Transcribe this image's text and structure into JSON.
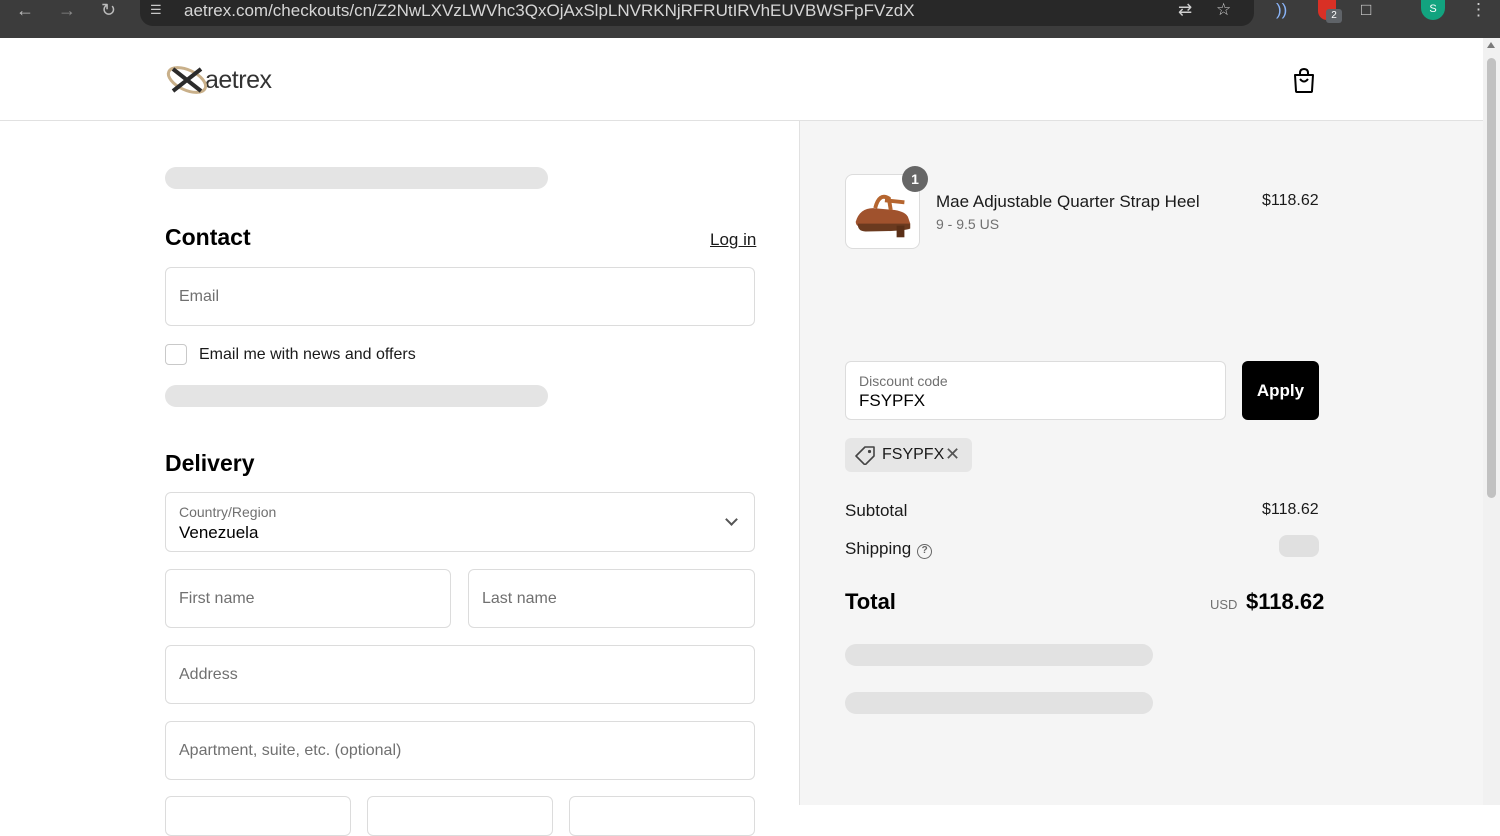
{
  "browser": {
    "url": "aetrex.com/checkouts/cn/Z2NwLXVzLWVhc3QxOjAxSlpLNVRKNjRFRUtIRVhEUVBWSFpFVzdX",
    "icons": [
      "back-arrow-icon",
      "forward-arrow-icon",
      "reload-icon",
      "site-info-icon",
      "translate-icon",
      "star-icon",
      "cast-icon",
      "extension-icon",
      "puzzle-icon",
      "profile-avatar",
      "menu-dots-icon"
    ],
    "extension_badge": "2",
    "avatar_letter": "S"
  },
  "header": {
    "logo_text": "aetrex",
    "cart_icon": "shopping-bag-icon"
  },
  "contact": {
    "title": "Contact",
    "login_label": "Log in",
    "email_placeholder": "Email",
    "newsletter_label": "Email me with news and offers"
  },
  "delivery": {
    "title": "Delivery",
    "country_label": "Country/Region",
    "country_value": "Venezuela",
    "first_name_placeholder": "First name",
    "last_name_placeholder": "Last name",
    "address_placeholder": "Address",
    "apartment_placeholder": "Apartment, suite, etc. (optional)"
  },
  "summary": {
    "item": {
      "quantity": "1",
      "name": "Mae Adjustable Quarter Strap Heel",
      "variant": "9 - 9.5 US",
      "price": "$118.62"
    },
    "discount": {
      "label": "Discount code",
      "value": "FSYPFX",
      "apply_label": "Apply",
      "applied_code": "FSYPFX"
    },
    "subtotal_label": "Subtotal",
    "subtotal_value": "$118.62",
    "shipping_label": "Shipping",
    "total_label": "Total",
    "currency": "USD",
    "total_value": "$118.62"
  },
  "colors": {
    "accent": "#000000",
    "summary_bg": "#f5f5f5",
    "skeleton": "#e4e4e4",
    "chrome": "#3c3c3c"
  }
}
